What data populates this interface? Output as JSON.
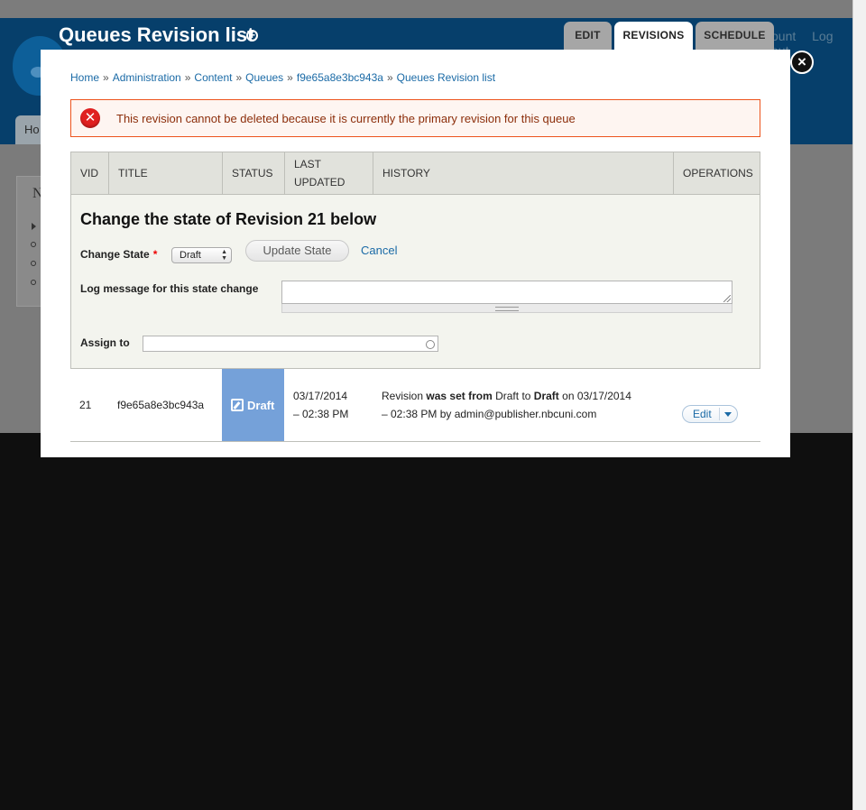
{
  "background": {
    "page_title": "Queues Revision list",
    "tabs": [
      "EDIT",
      "REVISIONS",
      "SCHEDULE"
    ],
    "user_links": [
      "ount",
      "Log out"
    ],
    "home_tab": "Ho",
    "panel_letter": "N"
  },
  "modal": {
    "breadcrumb": [
      "Home",
      "Administration",
      "Content",
      "Queues",
      "f9e65a8e3bc943a",
      "Queues Revision list"
    ],
    "breadcrumb_separator": "»",
    "error_message": "This revision cannot be deleted because it is currently the primary revision for this queue",
    "table": {
      "headers": [
        "VID",
        "TITLE",
        "STATUS",
        "LAST UPDATED",
        "HISTORY",
        "OPERATIONS"
      ],
      "state_form": {
        "heading": "Change the state of Revision 21 below",
        "change_state_label": "Change State",
        "required_mark": "*",
        "selected_state": "Draft",
        "update_button": "Update State",
        "cancel_link": "Cancel",
        "log_label": "Log message for this state change",
        "log_value": "",
        "assign_label": "Assign to",
        "assign_value": ""
      },
      "row": {
        "vid": "21",
        "title": "f9e65a8e3bc943a",
        "status": "Draft",
        "last_updated_line1": "03/17/2014",
        "last_updated_line2": "– 02:38 PM",
        "history": {
          "w1": "Revision",
          "w2": "was set from",
          "w3": "Draft",
          "w4": "to",
          "w5": "Draft",
          "w6": "on 03/17/2014",
          "w7": "– 02:38 PM by admin@publisher.nbcuni.com"
        },
        "operation": "Edit"
      }
    }
  },
  "colors": {
    "header_bg": "#063f6b",
    "status_draft": "#75a1d9",
    "error_border": "#ed541d",
    "link": "#1a6aa6"
  },
  "icons": {
    "close": "close-icon",
    "error": "error-icon",
    "shortcut": "plus-circle-icon",
    "draft": "edit-icon",
    "dropdown": "chevron-down-icon"
  }
}
